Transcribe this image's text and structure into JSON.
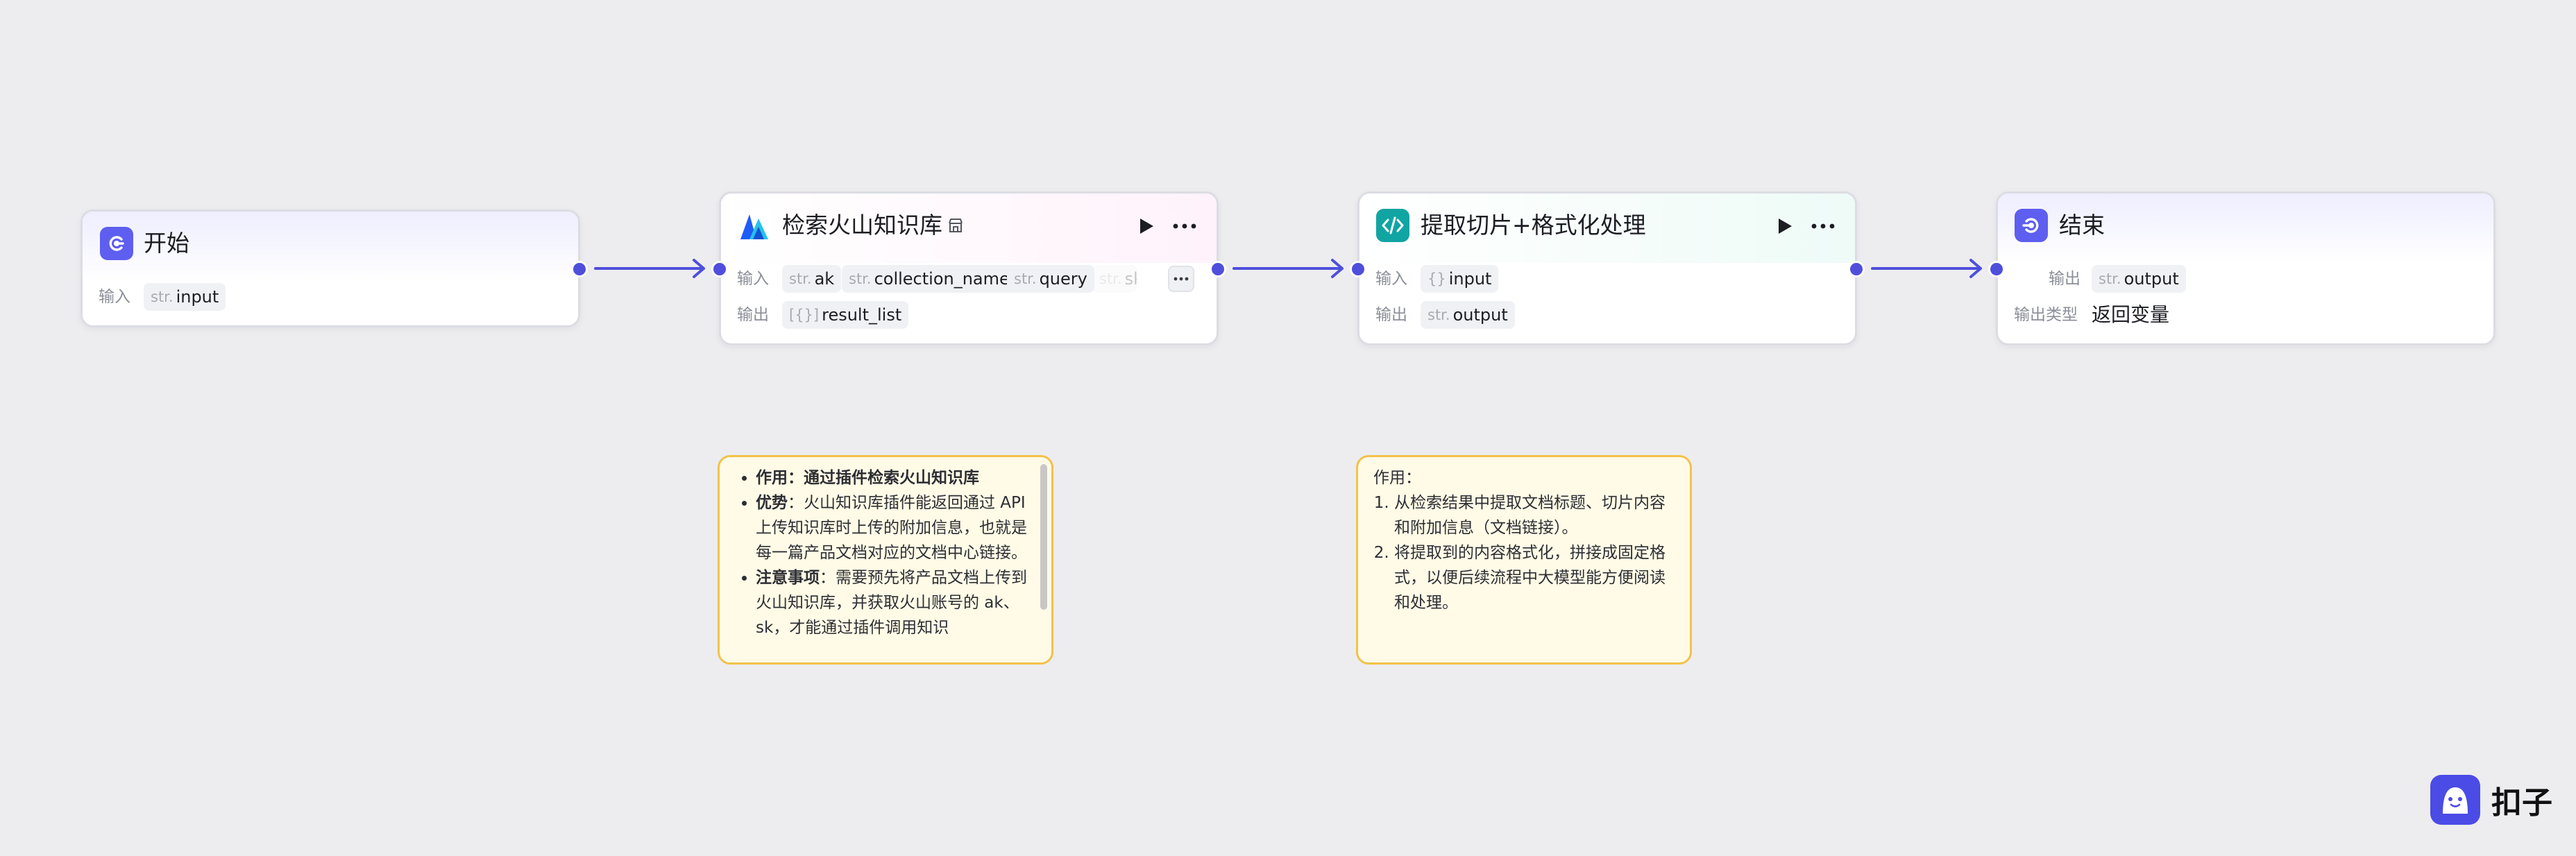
{
  "nodes": {
    "start": {
      "title": "开始",
      "input_label": "输入",
      "input_param": {
        "type": "str.",
        "name": "input"
      }
    },
    "search": {
      "title": "检索火山知识库",
      "input_label": "输入",
      "inputs": [
        {
          "type": "str.",
          "name": "ak"
        },
        {
          "type": "str.",
          "name": "collection_name"
        },
        {
          "type": "str.",
          "name": "query"
        },
        {
          "type": "str.",
          "name": "sk"
        }
      ],
      "output_label": "输出",
      "output_param": {
        "type": "[{}]",
        "name": "result_list"
      }
    },
    "code": {
      "title": "提取切片+格式化处理",
      "input_label": "输入",
      "input_param": {
        "type": "{}",
        "name": "input"
      },
      "output_label": "输出",
      "output_param": {
        "type": "str.",
        "name": "output"
      }
    },
    "end": {
      "title": "结束",
      "output_label": "输出",
      "output_param": {
        "type": "str.",
        "name": "output"
      },
      "output_type_label": "输出类型",
      "output_type_value": "返回变量"
    }
  },
  "notes": {
    "search_note": {
      "items": [
        {
          "label": "作用",
          "sep": "：",
          "text": "通过插件检索火山知识库"
        },
        {
          "label": "优势",
          "sep": "：",
          "text": "火山知识库插件能返回通过 API 上传知识库时上传的附加信息，也就是每一篇产品文档对应的文档中心链接。"
        },
        {
          "label": "注意事项",
          "sep": "：",
          "text": "需要预先将产品文档上传到火山知识库，并获取火山账号的 ak、sk，才能通过插件调用知识"
        }
      ]
    },
    "code_note": {
      "heading": "作用：",
      "items": [
        "从检索结果中提取文档标题、切片内容和附加信息（文档链接）。",
        "将提取到的内容格式化，拼接成固定格式，以便后续流程中大模型能方便阅读和处理。"
      ]
    }
  },
  "brand": {
    "name": "扣子"
  },
  "colors": {
    "accent": "#4f4fdc",
    "node_icon_purple": "#5e5ef0",
    "node_icon_teal": "#10a5a2",
    "note_border": "#f2c24a",
    "note_bg": "#fffbe7"
  }
}
